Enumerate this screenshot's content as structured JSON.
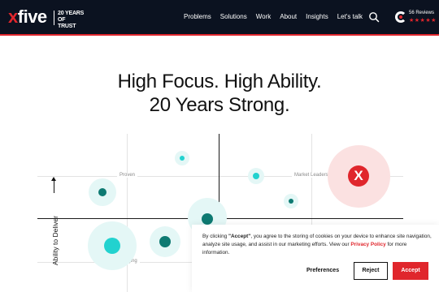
{
  "header": {
    "logo_x": "x",
    "logo_rest": "five",
    "tagline_line1": "20 YEARS OF",
    "tagline_line2": "TRUST",
    "nav": [
      "Problems",
      "Solutions",
      "Work",
      "About",
      "Insights",
      "Let's talk"
    ],
    "reviews_label": "56 Reviews",
    "stars": "★★★★★"
  },
  "hero": {
    "line1": "High Focus. High Ability.",
    "line2": "20 Years Strong."
  },
  "chart": {
    "y_axis_label": "Ability to Deliver",
    "quadrants": {
      "proven": "Proven",
      "market_leaders": "Market Leaders",
      "emerging": "Emerging"
    },
    "leader_mark": "X"
  },
  "cookie": {
    "text_pre": "By clicking ",
    "text_accept_word": "\"Accept\"",
    "text_mid": ", you agree to the storing of cookies on your device to enhance site navigation, analyze site usage, and assist in our marketing efforts. View our ",
    "privacy_link": "Privacy Policy",
    "text_post": " for more information.",
    "preferences_label": "Preferences",
    "reject_label": "Reject",
    "accept_label": "Accept"
  },
  "colors": {
    "brand_red": "#e0262c",
    "header_bg": "#0b1220",
    "teal_dark": "#0e7a72",
    "teal_bright": "#22d2cf",
    "halo": "#e4f7f6"
  }
}
